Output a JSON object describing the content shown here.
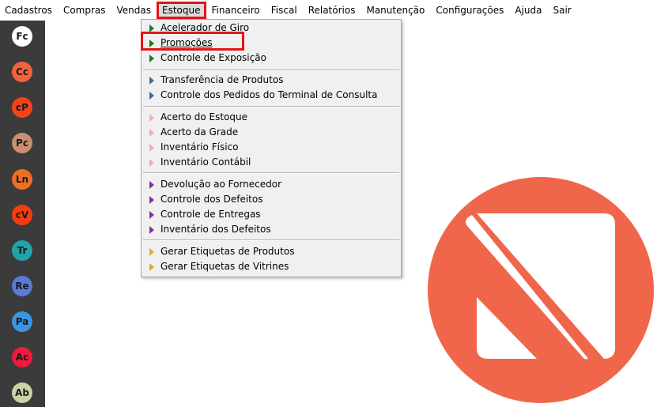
{
  "menubar": {
    "items": [
      "Cadastros",
      "Compras",
      "Vendas",
      "Estoque",
      "Financeiro",
      "Fiscal",
      "Relatórios",
      "Manutenção",
      "Configurações",
      "Ajuda",
      "Sair"
    ]
  },
  "sidebar": {
    "apps": [
      {
        "label": "Fc",
        "color": "#ffffff"
      },
      {
        "label": "Cc",
        "color": "#f1633d"
      },
      {
        "label": "cP",
        "color": "#f6421a"
      },
      {
        "label": "Pc",
        "color": "#c88f70"
      },
      {
        "label": "Ln",
        "color": "#ee6f24"
      },
      {
        "label": "cV",
        "color": "#f53d11"
      },
      {
        "label": "Tr",
        "color": "#21a3a8"
      },
      {
        "label": "Re",
        "color": "#5c79d6"
      },
      {
        "label": "Pa",
        "color": "#3a96e5"
      },
      {
        "label": "Ac",
        "color": "#ee1b3c"
      },
      {
        "label": "Ab",
        "color": "#c9d3a4"
      }
    ]
  },
  "dropdown": {
    "groups": [
      {
        "color": "#1a7d1a",
        "items": [
          "Acelerador de Giro",
          "Promoções",
          "Controle de Exposição"
        ]
      },
      {
        "color": "#3e6a99",
        "items": [
          "Transferência de Produtos",
          "Controle dos Pedidos do Terminal de Consulta"
        ]
      },
      {
        "color": "#f0a6d5",
        "items": [
          "Acerto do Estoque",
          "Acerto da Grade",
          "Inventário Físico",
          "Inventário Contábil"
        ]
      },
      {
        "color": "#8a2ab0",
        "items": [
          "Devolução ao Fornecedor",
          "Controle dos Defeitos",
          "Controle de Entregas",
          "Inventário dos Defeitos"
        ]
      },
      {
        "color": "#e8a820",
        "items": [
          "Gerar Etiquetas de Produtos",
          "Gerar Etiquetas de Vitrines"
        ]
      }
    ]
  },
  "logo": {
    "color": "#f0664a"
  }
}
